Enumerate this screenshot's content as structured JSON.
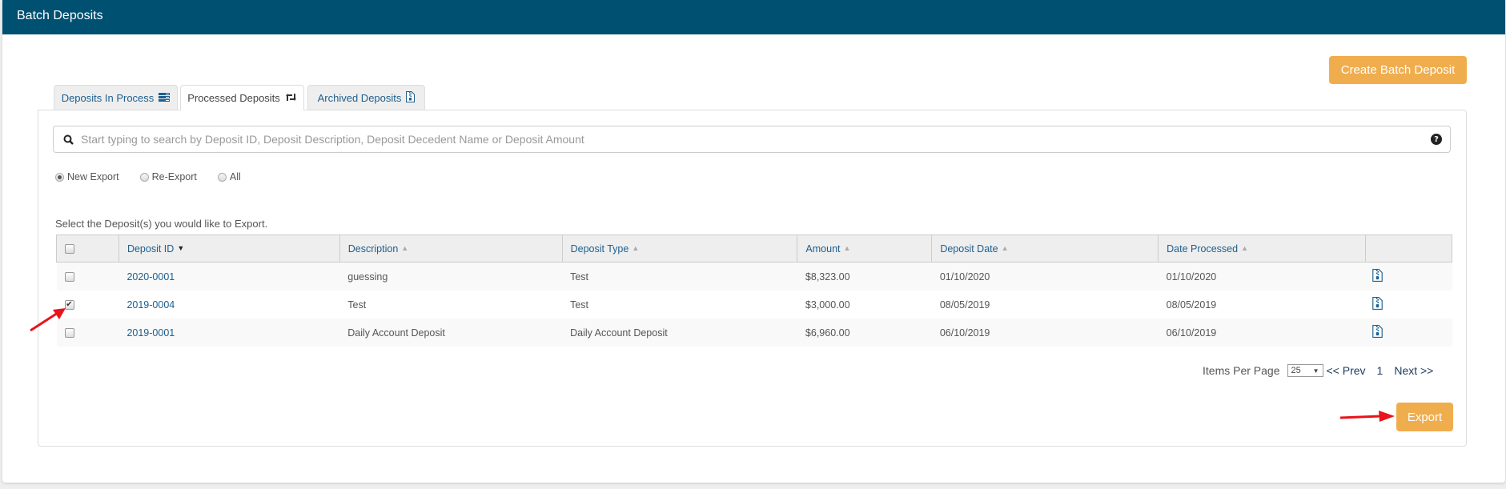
{
  "header": {
    "title": "Batch Deposits"
  },
  "actions": {
    "create_label": "Create Batch Deposit",
    "export_label": "Export"
  },
  "tabs": [
    {
      "label": "Deposits In Process",
      "icon": "list-icon",
      "active": false
    },
    {
      "label": "Processed Deposits",
      "icon": "retweet-icon",
      "active": true
    },
    {
      "label": "Archived Deposits",
      "icon": "file-zip-icon",
      "active": false
    }
  ],
  "search": {
    "placeholder": "Start typing to search by Deposit ID, Deposit Description, Deposit Decedent Name or Deposit Amount",
    "value": "",
    "help_glyph": "?"
  },
  "filters": [
    {
      "label": "New Export",
      "checked": true
    },
    {
      "label": "Re-Export",
      "checked": false
    },
    {
      "label": "All",
      "checked": false
    }
  ],
  "instruction": "Select the Deposit(s) you would like to Export.",
  "table": {
    "columns": [
      "Deposit ID",
      "Description",
      "Deposit Type",
      "Amount",
      "Deposit Date",
      "Date Processed"
    ],
    "sorted_column": "Deposit ID",
    "sort_glyph_active": "▼",
    "sort_glyph_inactive": "▲",
    "rows": [
      {
        "selected": false,
        "deposit_id": "2020-0001",
        "description": "guessing",
        "deposit_type": "Test",
        "amount": "$8,323.00",
        "deposit_date": "01/10/2020",
        "date_processed": "01/10/2020"
      },
      {
        "selected": true,
        "deposit_id": "2019-0004",
        "description": "Test",
        "deposit_type": "Test",
        "amount": "$3,000.00",
        "deposit_date": "08/05/2019",
        "date_processed": "08/05/2019"
      },
      {
        "selected": false,
        "deposit_id": "2019-0001",
        "description": "Daily Account Deposit",
        "deposit_type": "Daily Account Deposit",
        "amount": "$6,960.00",
        "deposit_date": "06/10/2019",
        "date_processed": "06/10/2019"
      }
    ]
  },
  "pagination": {
    "items_per_page_label": "Items Per Page",
    "items_per_page": "25",
    "prev_label": "<< Prev",
    "current_page": "1",
    "next_label": "Next >>"
  },
  "colors": {
    "header_bg": "#005071",
    "accent_orange": "#f0ad4e",
    "link_blue": "#1d5f8e",
    "annotation_red": "#e8141b"
  }
}
